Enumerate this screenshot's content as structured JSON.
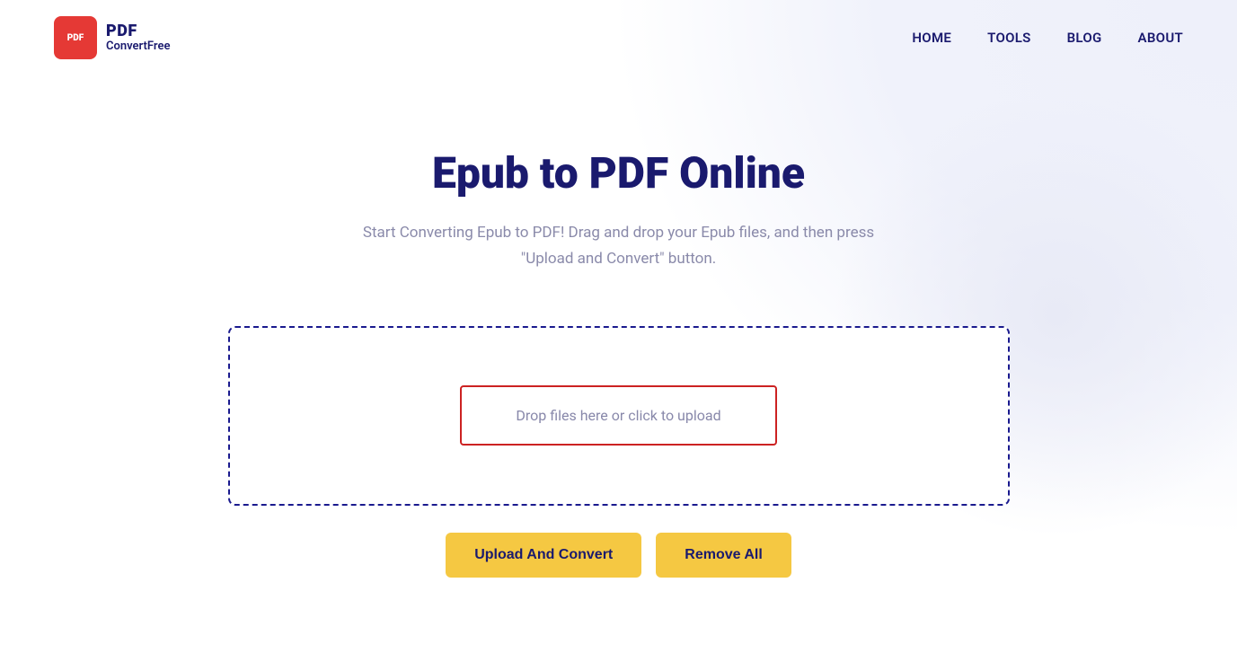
{
  "brand": {
    "logo_text_pdf": "PDF",
    "logo_text_sub": "ConvertFree",
    "logo_icon_label": "PDF"
  },
  "nav": {
    "home": "HOME",
    "tools": "TOOLS",
    "blog": "BLOG",
    "about": "ABOUT"
  },
  "hero": {
    "title": "Epub to PDF Online",
    "subtitle": "Start Converting Epub to PDF! Drag and drop your Epub files, and then press \"Upload and Convert\" button."
  },
  "upload": {
    "drop_text": "Drop files here or click to upload",
    "upload_button": "Upload And Convert",
    "remove_button": "Remove All"
  },
  "colors": {
    "accent": "#f5c842",
    "primary": "#1a1a6e",
    "border_dashed": "#1a1a8e",
    "dropzone_border": "#cc2222"
  }
}
